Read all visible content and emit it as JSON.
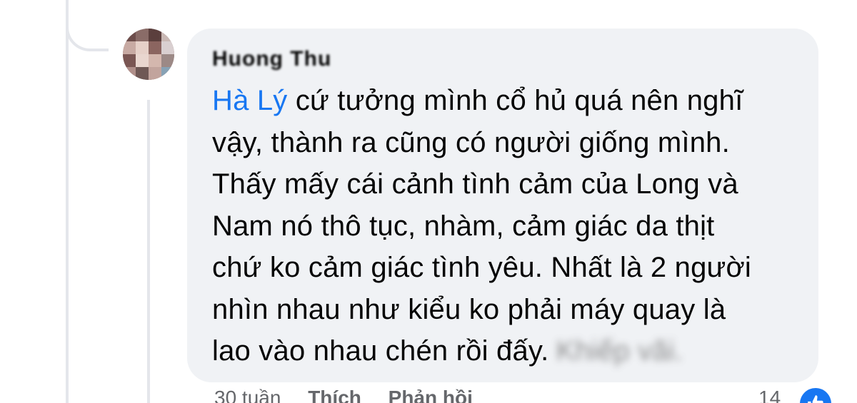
{
  "comment": {
    "author": "Huong Thu",
    "mention": "Hà Lý",
    "lines": [
      " cứ tưởng mình cổ hủ quá nên nghĩ",
      "vậy, thành ra cũng có người giống mình.",
      "Thấy mấy cái cảnh tình cảm của Long và",
      "Nam nó thô tục, nhàm, cảm giác da thịt",
      "chứ ko cảm giác tình yêu. Nhất là 2 người",
      "nhìn nhau như kiểu ko phải máy quay là",
      "lao vào nhau chén rồi đấy."
    ],
    "blurred_suffix": "Khiếp vãi."
  },
  "actions": {
    "time": "30 tuần",
    "like": "Thích",
    "reply": "Phản hồi",
    "reaction_count": "14"
  },
  "icons": {
    "avatar": "avatar",
    "like": "like-thumb-icon"
  },
  "colors": {
    "bubble": "#f0f2f5",
    "mention": "#1877f2",
    "text": "#050505",
    "meta": "#65676b",
    "like_badge": "#1877f2"
  }
}
